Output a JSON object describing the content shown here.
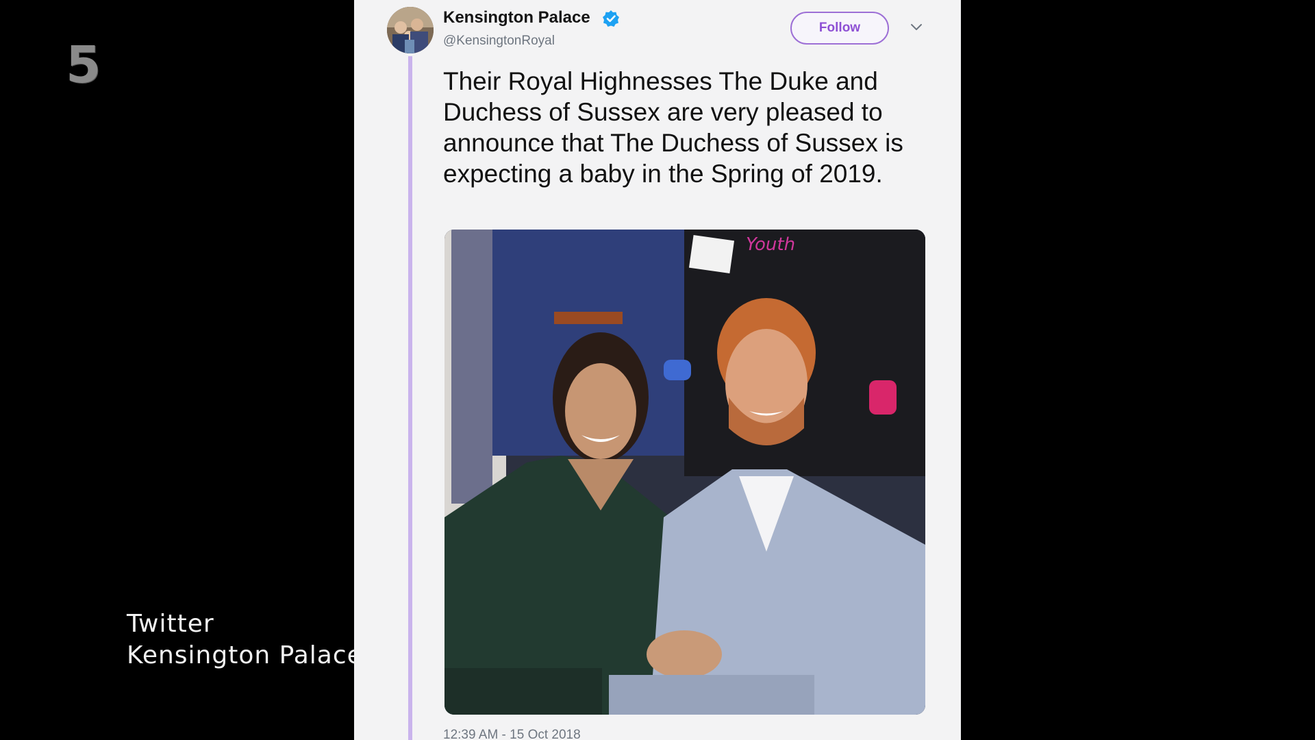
{
  "broadcast": {
    "channel_logo": "5",
    "caption_line1": "Twitter",
    "caption_line2": "Kensington Palace"
  },
  "tweet": {
    "display_name": "Kensington Palace",
    "verified": true,
    "handle": "@KensingtonRoyal",
    "follow_label": "Follow",
    "text": "Their Royal Highnesses The Duke and Duchess of Sussex are very pleased to announce that The Duchess of Sussex is expecting a baby in the Spring of 2019.",
    "timestamp": "12:39 AM - 15 Oct 2018",
    "photo_badge_text": "Youth"
  },
  "colors": {
    "follow_accent": "#8e50d4",
    "verified_blue": "#1da1f2",
    "thread_line": "#c9b3ec"
  },
  "icons": {
    "verified": "verified-badge-icon",
    "more": "chevron-down-icon"
  }
}
